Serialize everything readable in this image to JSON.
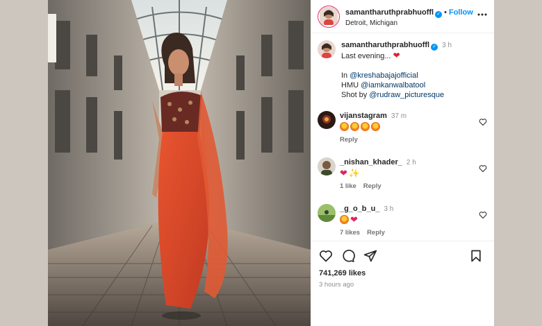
{
  "post": {
    "username": "samantharuthprabhuoffl",
    "location": "Detroit, Michigan",
    "follow_label": "Follow",
    "dot": "•",
    "verified_mark": "✓"
  },
  "caption": {
    "username": "samantharuthprabhuoffl",
    "time": "3 h",
    "text": "Last evening...",
    "heart": "❤",
    "line_in_prefix": "In ",
    "line_in_mention": "@kreshabajajofficial",
    "line_hmu_prefix": "HMU ",
    "line_hmu_mention": "@iamkanwalbatool",
    "line_shot_prefix": "Shot by ",
    "line_shot_mention": "@rudraw_picturesque"
  },
  "comments": [
    {
      "username": "vijanstagram",
      "time": "37 m",
      "emojis": [
        "fire",
        "fire",
        "fire",
        "fire"
      ],
      "actions": [
        "Reply"
      ]
    },
    {
      "username": "_nishan_khader_",
      "time": "2 h",
      "emojis": [
        "heart",
        "sparkle"
      ],
      "actions": [
        "1 like",
        "Reply"
      ]
    },
    {
      "username": "_g_o_b_u_",
      "time": "3 h",
      "emojis": [
        "fire",
        "heart"
      ],
      "actions": [
        "7 likes",
        "Reply"
      ]
    }
  ],
  "glyphs": {
    "heart": "❤",
    "sparkle": "✨"
  },
  "stats": {
    "likes": "741,269 likes",
    "posted_ago": "3 hours ago"
  },
  "icons": {
    "more": "more-options-icon",
    "like": "heart-icon",
    "comment": "comment-icon",
    "share": "share-icon",
    "save": "bookmark-icon",
    "next": "chevron-right-icon"
  },
  "colors": {
    "accent": "#0095f6",
    "mention": "#00376b",
    "saree": "#d9452a",
    "background": "#ccc6bf"
  }
}
